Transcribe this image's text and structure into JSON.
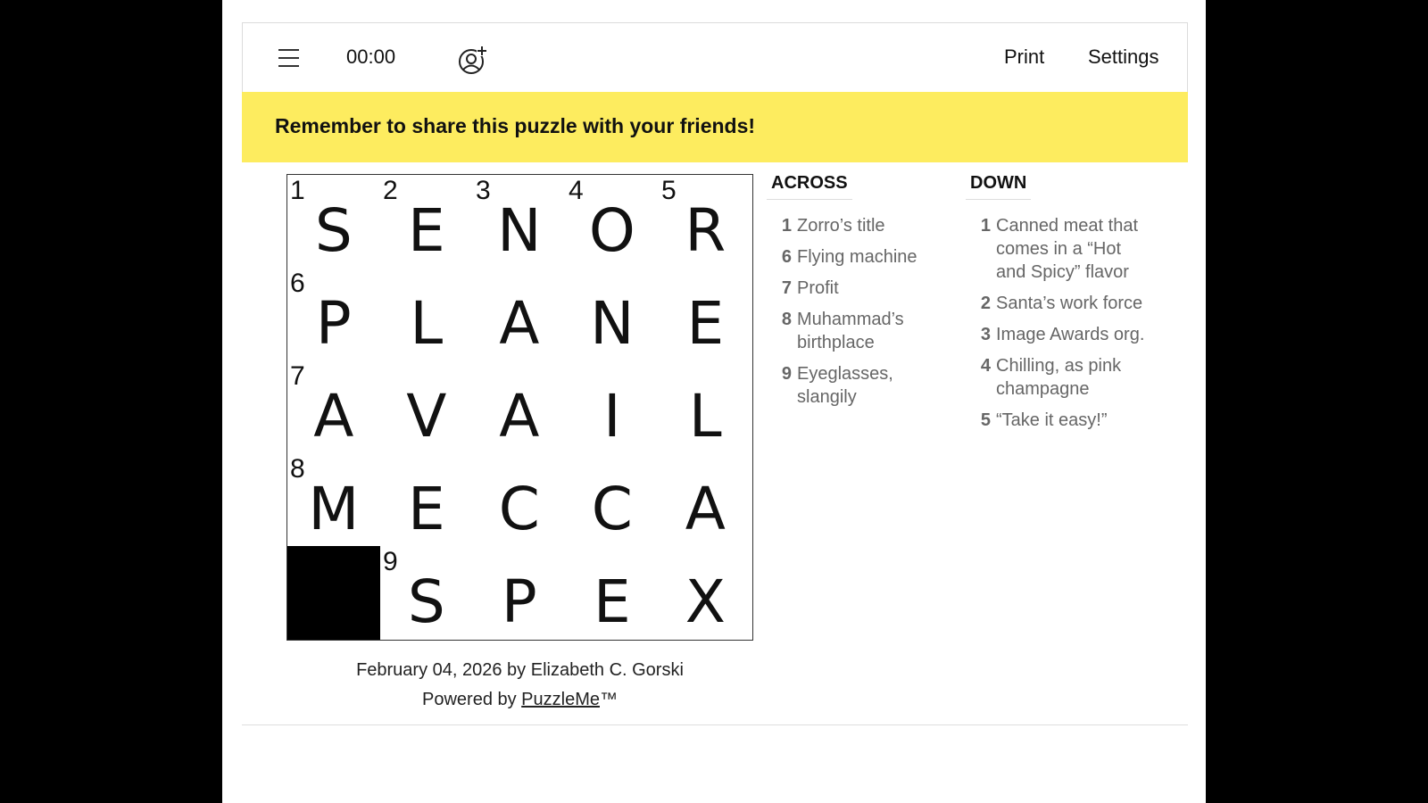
{
  "toolbar": {
    "timer": "00:00",
    "print_label": "Print",
    "settings_label": "Settings"
  },
  "banner": {
    "text": "Remember to share this puzzle with your friends!"
  },
  "grid": {
    "rows": [
      [
        {
          "num": "1",
          "letter": "S"
        },
        {
          "num": "2",
          "letter": "E"
        },
        {
          "num": "3",
          "letter": "N"
        },
        {
          "num": "4",
          "letter": "O"
        },
        {
          "num": "5",
          "letter": "R"
        }
      ],
      [
        {
          "num": "6",
          "letter": "P"
        },
        {
          "num": "",
          "letter": "L"
        },
        {
          "num": "",
          "letter": "A"
        },
        {
          "num": "",
          "letter": "N"
        },
        {
          "num": "",
          "letter": "E"
        }
      ],
      [
        {
          "num": "7",
          "letter": "A"
        },
        {
          "num": "",
          "letter": "V"
        },
        {
          "num": "",
          "letter": "A"
        },
        {
          "num": "",
          "letter": "I"
        },
        {
          "num": "",
          "letter": "L"
        }
      ],
      [
        {
          "num": "8",
          "letter": "M"
        },
        {
          "num": "",
          "letter": "E"
        },
        {
          "num": "",
          "letter": "C"
        },
        {
          "num": "",
          "letter": "C"
        },
        {
          "num": "",
          "letter": "A"
        }
      ],
      [
        {
          "black": true
        },
        {
          "num": "9",
          "letter": "S"
        },
        {
          "num": "",
          "letter": "P"
        },
        {
          "num": "",
          "letter": "E"
        },
        {
          "num": "",
          "letter": "X"
        }
      ]
    ]
  },
  "clues": {
    "across_title": "ACROSS",
    "down_title": "DOWN",
    "across": [
      {
        "num": "1",
        "text": "Zorro’s title"
      },
      {
        "num": "6",
        "text": "Flying machine"
      },
      {
        "num": "7",
        "text": "Profit"
      },
      {
        "num": "8",
        "text": "Muhammad’s birthplace"
      },
      {
        "num": "9",
        "text": "Eyeglasses, slangily"
      }
    ],
    "down": [
      {
        "num": "1",
        "text": "Canned meat that comes in a “Hot and Spicy” flavor"
      },
      {
        "num": "2",
        "text": "Santa’s work force"
      },
      {
        "num": "3",
        "text": "Image Awards org."
      },
      {
        "num": "4",
        "text": "Chilling, as pink champagne"
      },
      {
        "num": "5",
        "text": "“Take it easy!”"
      }
    ]
  },
  "footer": {
    "byline": "February 04, 2026 by Elizabeth C. Gorski",
    "powered_prefix": "Powered by ",
    "powered_link": "PuzzleMe",
    "powered_suffix": "™"
  },
  "icons": {
    "menu": "menu-icon",
    "share": "add-user-icon"
  },
  "colors": {
    "banner": "#fdec5f",
    "black_cell": "#000000"
  }
}
